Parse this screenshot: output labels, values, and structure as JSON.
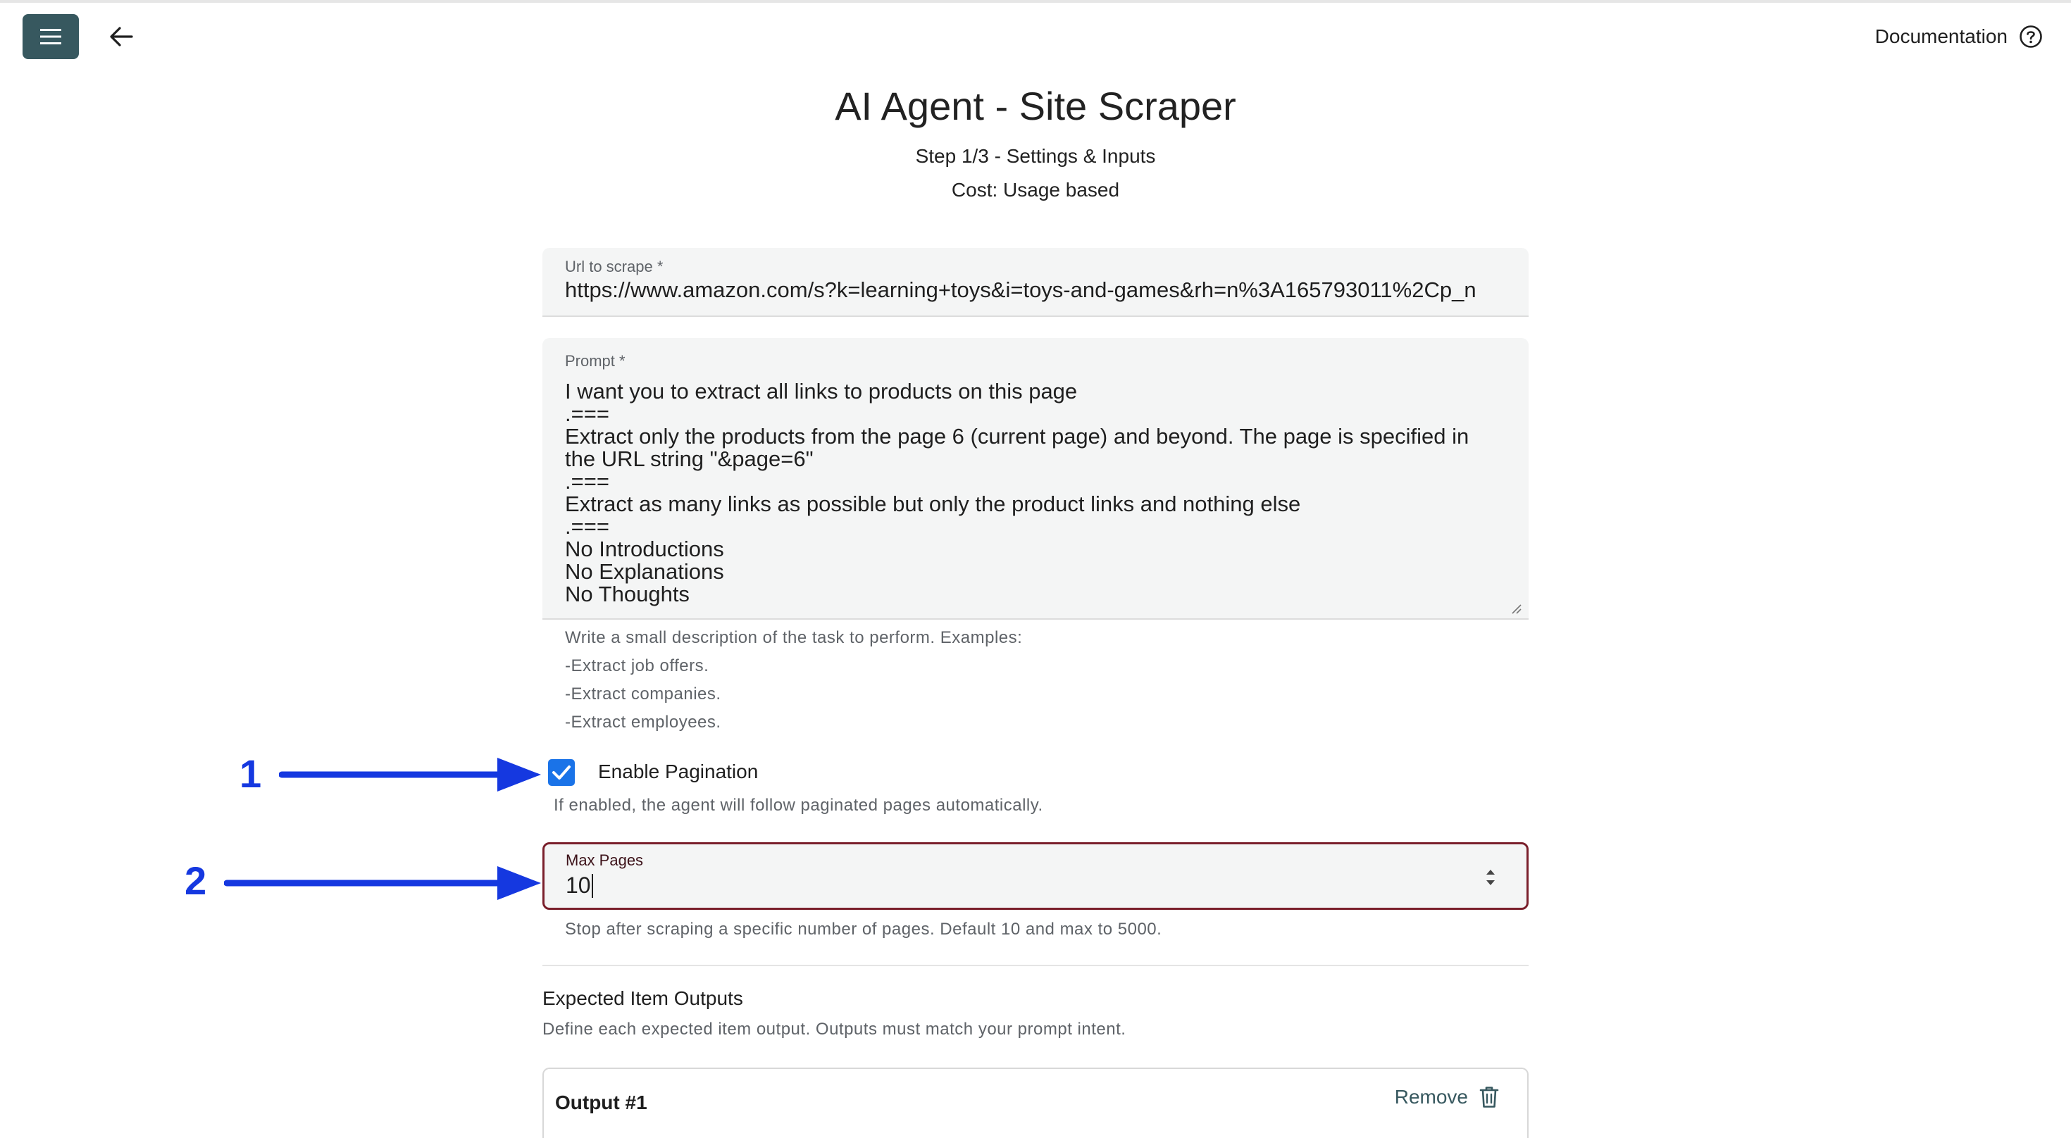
{
  "header": {
    "documentation_label": "Documentation",
    "menu_icon": "hamburger-menu-icon",
    "back_icon": "arrow-left-icon",
    "help_icon": "help-circle-icon"
  },
  "page": {
    "title": "AI Agent - Site Scraper",
    "step": "Step 1/3 - Settings & Inputs",
    "cost": "Cost: Usage based"
  },
  "url_field": {
    "label": "Url to scrape *",
    "value": "https://www.amazon.com/s?k=learning+toys&i=toys-and-games&rh=n%3A165793011%2Cp_n"
  },
  "prompt_field": {
    "label": "Prompt *",
    "value": "I want you to extract all links to products on this page\n.===\nExtract only the products from the page 6 (current page) and beyond. The page is specified in the URL string \"&page=6\"\n.===\nExtract as many links as possible but only the product links and nothing else\n.===\nNo Introductions\nNo Explanations\nNo Thoughts",
    "hints": [
      "Write a small description of the task to perform. Examples:",
      "-Extract job offers.",
      "-Extract companies.",
      "-Extract employees."
    ]
  },
  "pagination": {
    "label": "Enable Pagination",
    "checked": true,
    "hint": "If enabled, the agent will follow paginated pages automatically."
  },
  "max_pages": {
    "label": "Max Pages",
    "value": "10",
    "hint": "Stop after scraping a specific number of pages. Default 10 and max to 5000."
  },
  "outputs": {
    "title": "Expected Item Outputs",
    "description": "Define each expected item output. Outputs must match your prompt intent.",
    "items": [
      {
        "title": "Output #1",
        "remove_label": "Remove"
      }
    ]
  },
  "annotations": [
    {
      "number": "1"
    },
    {
      "number": "2"
    }
  ],
  "colors": {
    "menu_button": "#37585f",
    "checkbox": "#1a73e8",
    "focus_border": "#7a1f2b",
    "annotation": "#1538e0"
  }
}
